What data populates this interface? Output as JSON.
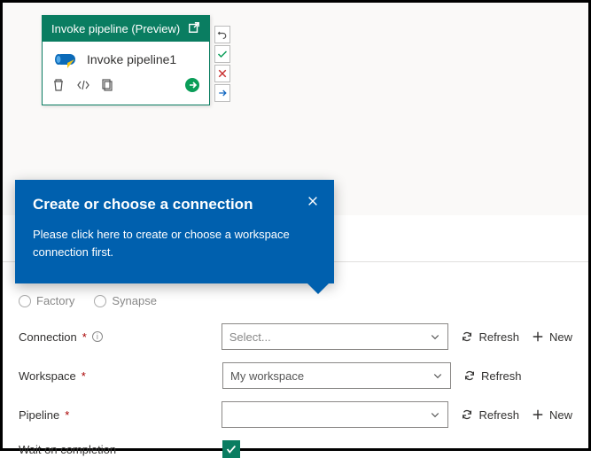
{
  "activity": {
    "header": "Invoke pipeline (Preview)",
    "name": "Invoke pipeline1"
  },
  "callout": {
    "title": "Create or choose a connection",
    "body": "Please click here to create or choose a workspace connection first."
  },
  "typeOptions": {
    "factory": "Factory",
    "synapse": "Synapse"
  },
  "form": {
    "connection": {
      "label": "Connection",
      "placeholder": "Select...",
      "refresh": "Refresh",
      "new": "New"
    },
    "workspace": {
      "label": "Workspace",
      "value": "My workspace",
      "refresh": "Refresh"
    },
    "pipeline": {
      "label": "Pipeline",
      "value": "",
      "refresh": "Refresh",
      "new": "New"
    },
    "wait": {
      "label": "Wait on completion",
      "checked": true
    }
  }
}
